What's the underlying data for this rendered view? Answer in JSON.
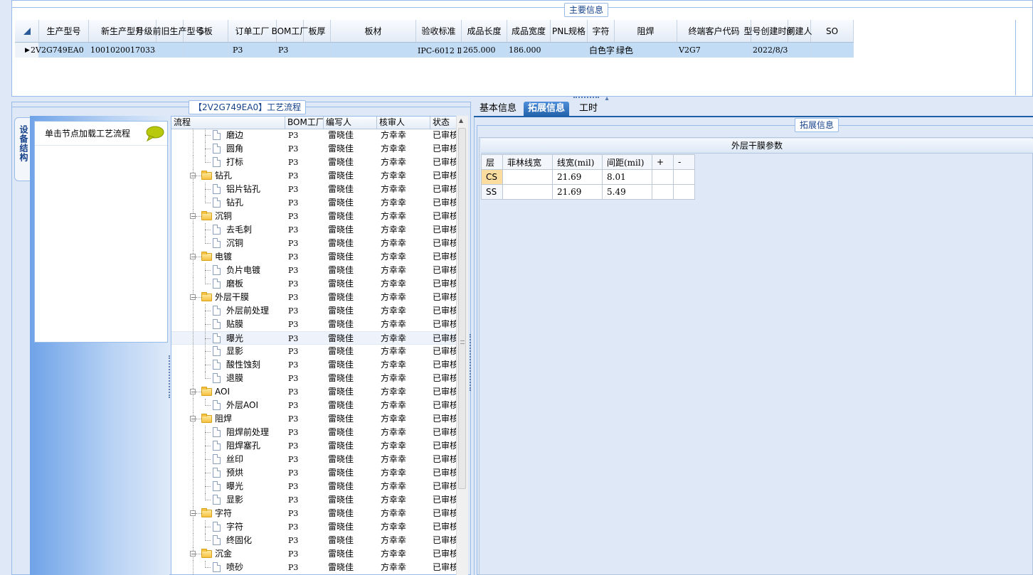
{
  "main": {
    "group_title": "主要信息",
    "columns": [
      "生产型号",
      "新生产型号",
      "升级前旧生产型号",
      "S板",
      "订单工厂",
      "BOM工厂",
      "板厚",
      "板材",
      "验收标准",
      "成品长度",
      "成品宽度",
      "PNL规格",
      "字符",
      "阻焊",
      "终端客户代码",
      "型号创建时间",
      "创建人",
      "SO"
    ],
    "row": [
      "2V2G749EA0",
      "10010200170333",
      "",
      "",
      "P3",
      "P3",
      "",
      "",
      "IPC-6012 Ⅱ级",
      "265.000",
      "186.000",
      "",
      "白色字符",
      "绿色",
      "V2G7",
      "2022/8/31",
      "",
      ""
    ]
  },
  "left": {
    "side_tab": "设备结构",
    "node_hint": "单击节点加载工艺流程",
    "process_title": "【2V2G749EA0】工艺流程",
    "columns": [
      "流程",
      "BOM工厂",
      "编写人",
      "核审人",
      "状态"
    ],
    "rows": [
      {
        "name": "磨边",
        "level": 2,
        "bom": "P3",
        "writer": "雷晓佳",
        "reviewer": "方幸幸",
        "status": "已审核"
      },
      {
        "name": "圆角",
        "level": 2,
        "bom": "P3",
        "writer": "雷晓佳",
        "reviewer": "方幸幸",
        "status": "已审核"
      },
      {
        "name": "打标",
        "level": 2,
        "bom": "P3",
        "writer": "雷晓佳",
        "reviewer": "方幸幸",
        "status": "已审核"
      },
      {
        "name": "钻孔",
        "level": 1,
        "bom": "P3",
        "writer": "雷晓佳",
        "reviewer": "方幸幸",
        "status": "已审核"
      },
      {
        "name": "铝片钻孔",
        "level": 2,
        "bom": "P3",
        "writer": "雷晓佳",
        "reviewer": "方幸幸",
        "status": "已审核"
      },
      {
        "name": "钻孔",
        "level": 2,
        "bom": "P3",
        "writer": "雷晓佳",
        "reviewer": "方幸幸",
        "status": "已审核"
      },
      {
        "name": "沉铜",
        "level": 1,
        "bom": "P3",
        "writer": "雷晓佳",
        "reviewer": "方幸幸",
        "status": "已审核"
      },
      {
        "name": "去毛刺",
        "level": 2,
        "bom": "P3",
        "writer": "雷晓佳",
        "reviewer": "方幸幸",
        "status": "已审核"
      },
      {
        "name": "沉铜",
        "level": 2,
        "bom": "P3",
        "writer": "雷晓佳",
        "reviewer": "方幸幸",
        "status": "已审核"
      },
      {
        "name": "电镀",
        "level": 1,
        "bom": "P3",
        "writer": "雷晓佳",
        "reviewer": "方幸幸",
        "status": "已审核"
      },
      {
        "name": "负片电镀",
        "level": 2,
        "bom": "P3",
        "writer": "雷晓佳",
        "reviewer": "方幸幸",
        "status": "已审核"
      },
      {
        "name": "磨板",
        "level": 2,
        "bom": "P3",
        "writer": "雷晓佳",
        "reviewer": "方幸幸",
        "status": "已审核"
      },
      {
        "name": "外层干膜",
        "level": 1,
        "bom": "P3",
        "writer": "雷晓佳",
        "reviewer": "方幸幸",
        "status": "已审核"
      },
      {
        "name": "外层前处理",
        "level": 2,
        "bom": "P3",
        "writer": "雷晓佳",
        "reviewer": "方幸幸",
        "status": "已审核"
      },
      {
        "name": "贴膜",
        "level": 2,
        "bom": "P3",
        "writer": "雷晓佳",
        "reviewer": "方幸幸",
        "status": "已审核"
      },
      {
        "name": "曝光",
        "level": 2,
        "bom": "P3",
        "writer": "雷晓佳",
        "reviewer": "方幸幸",
        "status": "已审核",
        "selected": true
      },
      {
        "name": "显影",
        "level": 2,
        "bom": "P3",
        "writer": "雷晓佳",
        "reviewer": "方幸幸",
        "status": "已审核"
      },
      {
        "name": "酸性蚀刻",
        "level": 2,
        "bom": "P3",
        "writer": "雷晓佳",
        "reviewer": "方幸幸",
        "status": "已审核"
      },
      {
        "name": "退膜",
        "level": 2,
        "bom": "P3",
        "writer": "雷晓佳",
        "reviewer": "方幸幸",
        "status": "已审核"
      },
      {
        "name": "AOI",
        "level": 1,
        "bom": "P3",
        "writer": "雷晓佳",
        "reviewer": "方幸幸",
        "status": "已审核"
      },
      {
        "name": "外层AOI",
        "level": 2,
        "bom": "P3",
        "writer": "雷晓佳",
        "reviewer": "方幸幸",
        "status": "已审核"
      },
      {
        "name": "阻焊",
        "level": 1,
        "bom": "P3",
        "writer": "雷晓佳",
        "reviewer": "方幸幸",
        "status": "已审核"
      },
      {
        "name": "阻焊前处理",
        "level": 2,
        "bom": "P3",
        "writer": "雷晓佳",
        "reviewer": "方幸幸",
        "status": "已审核"
      },
      {
        "name": "阻焊塞孔",
        "level": 2,
        "bom": "P3",
        "writer": "雷晓佳",
        "reviewer": "方幸幸",
        "status": "已审核"
      },
      {
        "name": "丝印",
        "level": 2,
        "bom": "P3",
        "writer": "雷晓佳",
        "reviewer": "方幸幸",
        "status": "已审核"
      },
      {
        "name": "预烘",
        "level": 2,
        "bom": "P3",
        "writer": "雷晓佳",
        "reviewer": "方幸幸",
        "status": "已审核"
      },
      {
        "name": "曝光",
        "level": 2,
        "bom": "P3",
        "writer": "雷晓佳",
        "reviewer": "方幸幸",
        "status": "已审核"
      },
      {
        "name": "显影",
        "level": 2,
        "bom": "P3",
        "writer": "雷晓佳",
        "reviewer": "方幸幸",
        "status": "已审核"
      },
      {
        "name": "字符",
        "level": 1,
        "bom": "P3",
        "writer": "雷晓佳",
        "reviewer": "方幸幸",
        "status": "已审核"
      },
      {
        "name": "字符",
        "level": 2,
        "bom": "P3",
        "writer": "雷晓佳",
        "reviewer": "方幸幸",
        "status": "已审核"
      },
      {
        "name": "终固化",
        "level": 2,
        "bom": "P3",
        "writer": "雷晓佳",
        "reviewer": "方幸幸",
        "status": "已审核"
      },
      {
        "name": "沉金",
        "level": 1,
        "bom": "P3",
        "writer": "雷晓佳",
        "reviewer": "方幸幸",
        "status": "已审核"
      },
      {
        "name": "喷砂",
        "level": 2,
        "bom": "P3",
        "writer": "雷晓佳",
        "reviewer": "方幸幸",
        "status": "已审核"
      }
    ]
  },
  "right": {
    "tabs": [
      "基本信息",
      "拓展信息",
      "工时"
    ],
    "active_tab": 1,
    "ext_title": "拓展信息",
    "film_title": "外层干膜参数",
    "film_columns": [
      "层",
      "菲林线宽",
      "线宽(mil)",
      "间距(mil)",
      "+",
      "-"
    ],
    "film_rows": [
      {
        "layer": "CS",
        "film_width": "",
        "width": "21.69",
        "spacing": "8.01",
        "plus": "",
        "minus": ""
      },
      {
        "layer": "SS",
        "film_width": "",
        "width": "21.69",
        "spacing": "5.49",
        "plus": "",
        "minus": ""
      }
    ]
  },
  "colors": {
    "accent": "#1f5fa8",
    "selected_row": "#c2dcf5",
    "panel": "#dfe8f6",
    "highlight_layer": "#fbdda0"
  }
}
